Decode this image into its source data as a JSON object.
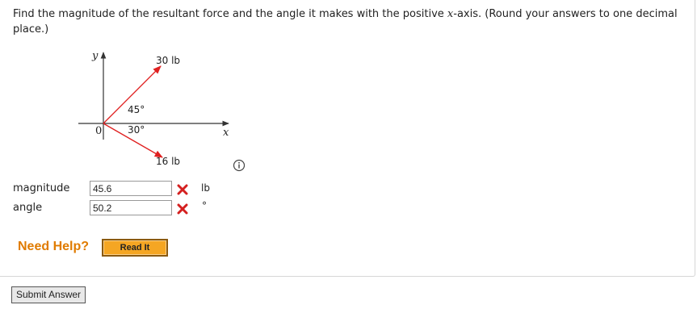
{
  "question": {
    "text_before": "Find the magnitude of the resultant force and the angle it makes with the positive ",
    "italic_var": "x",
    "text_after": "-axis. (Round your answers to one decimal place.)"
  },
  "diagram": {
    "y_label": "y",
    "x_label": "x",
    "origin_label": "0",
    "force1_label": "30 lb",
    "force2_label": "16 lb",
    "angle1_label": "45°",
    "angle2_label": "30°",
    "arrow_color": "#e02020"
  },
  "answers": {
    "magnitude_label": "magnitude",
    "magnitude_value": "45.6",
    "magnitude_unit": "lb",
    "angle_label": "angle",
    "angle_value": "50.2",
    "angle_unit": "°",
    "status": "incorrect",
    "status_icon": "red-x-icon"
  },
  "help": {
    "need_help": "Need Help?",
    "read_it": "Read It"
  },
  "submit_label": "Submit Answer",
  "info_icon": "info-icon"
}
